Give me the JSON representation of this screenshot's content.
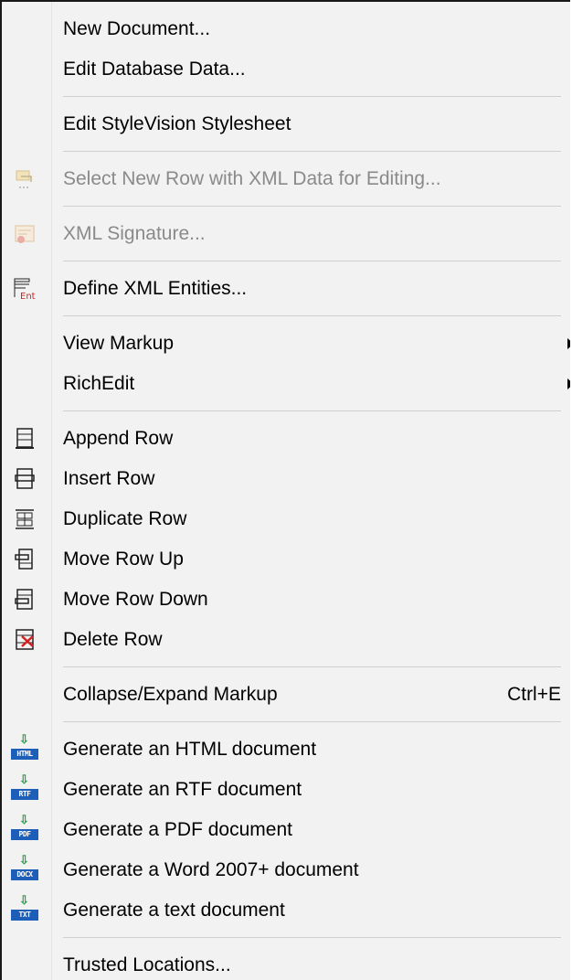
{
  "menu": {
    "new_document": "New Document...",
    "edit_database_data": "Edit Database Data...",
    "edit_stylevision": "Edit StyleVision Stylesheet",
    "select_new_row": "Select New Row with XML Data for Editing...",
    "xml_signature": "XML Signature...",
    "define_entities": "Define XML Entities...",
    "view_markup": "View Markup",
    "richedit": "RichEdit",
    "append_row": "Append Row",
    "insert_row": "Insert Row",
    "duplicate_row": "Duplicate Row",
    "move_row_up": "Move Row Up",
    "move_row_down": "Move Row Down",
    "delete_row": "Delete Row",
    "collapse_expand": "Collapse/Expand Markup",
    "collapse_shortcut": "Ctrl+E",
    "gen_html": "Generate an HTML document",
    "gen_rtf": "Generate an RTF document",
    "gen_pdf": "Generate a PDF document",
    "gen_word": "Generate a Word 2007+ document",
    "gen_text": "Generate a text document",
    "trusted_locations": "Trusted Locations..."
  },
  "icons": {
    "html_tag": "HTML",
    "rtf_tag": "RTF",
    "pdf_tag": "PDF",
    "docx_tag": "DOCX",
    "txt_tag": "TXT",
    "arrow_glyph": "⇩",
    "entity_tag": "Ent"
  }
}
